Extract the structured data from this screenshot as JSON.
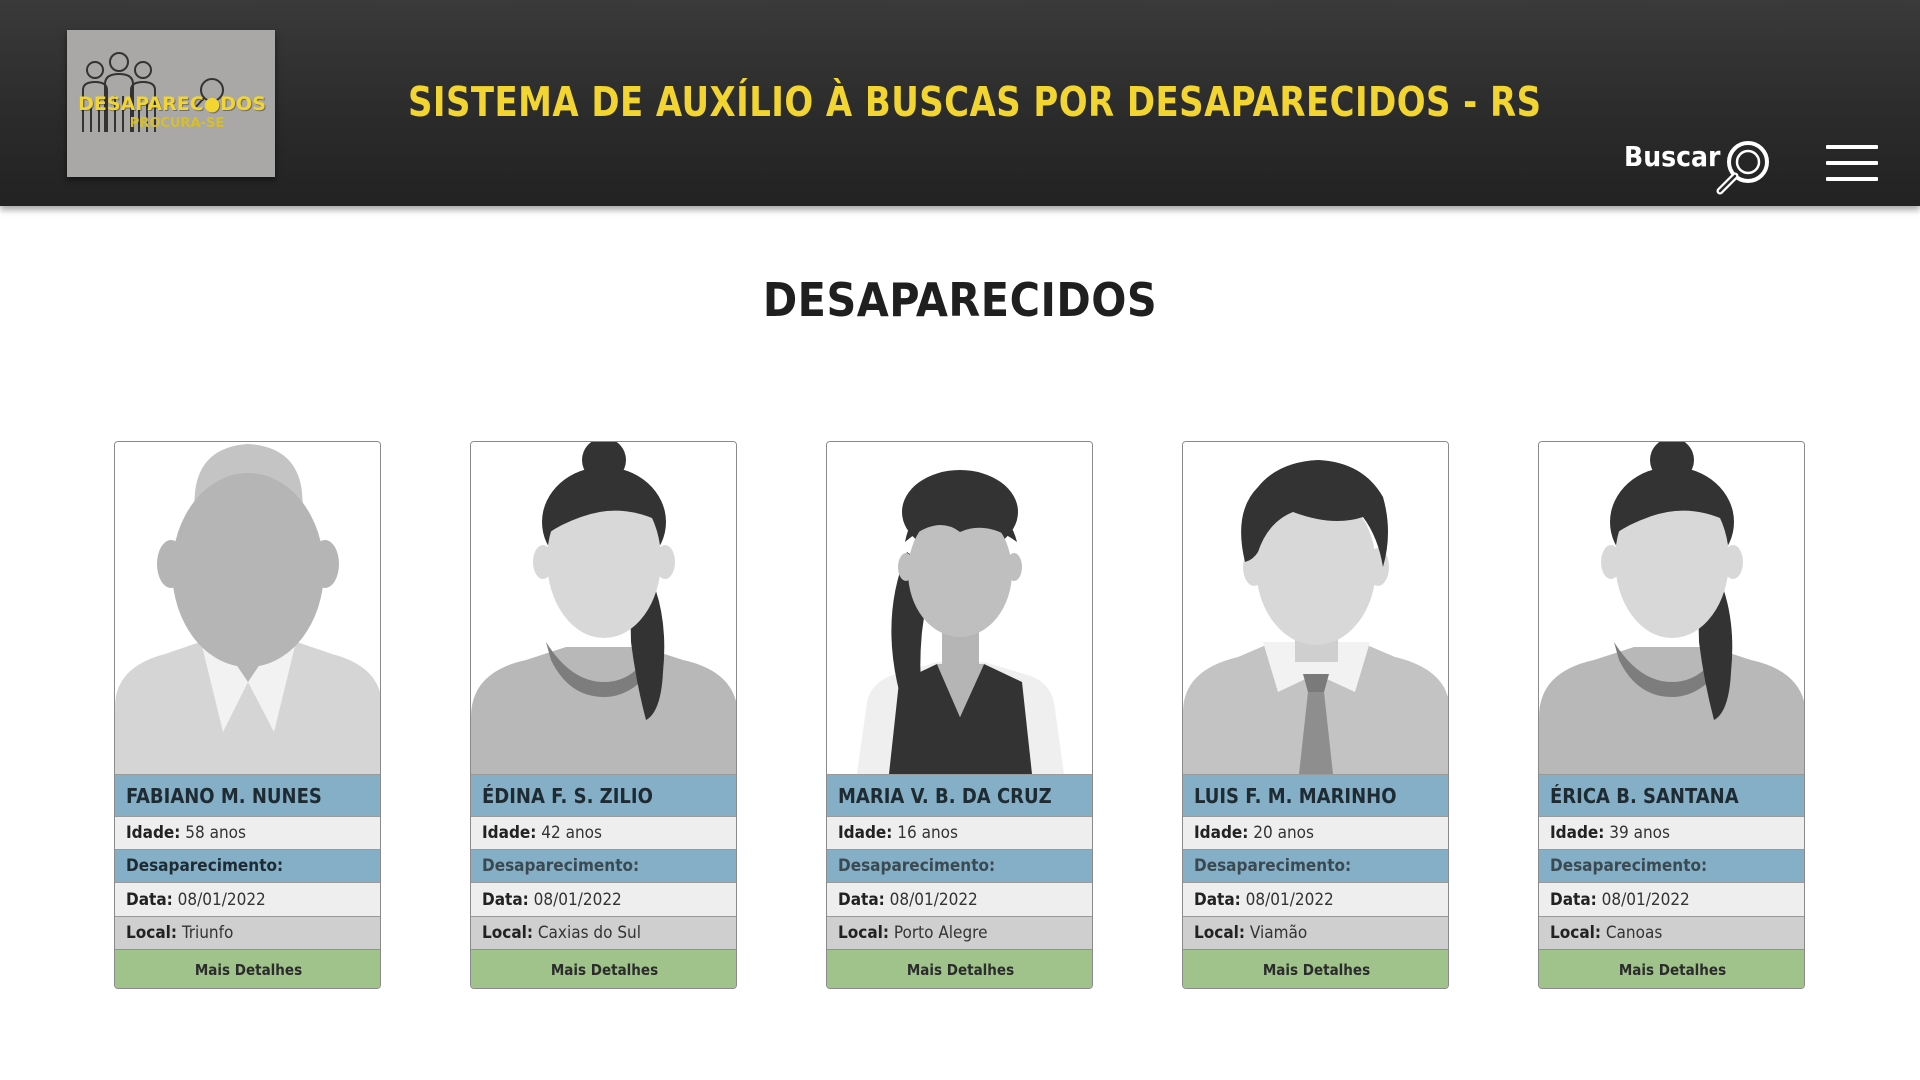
{
  "header": {
    "logo_title": "DESAPAREC●DOS",
    "logo_subtitle": "PROCURA-SE",
    "site_title": "SISTEMA DE AUXÍLIO À BUSCAS POR DESAPARECIDOS - RS",
    "search_label": "Buscar"
  },
  "section_title": "DESAPARECIDOS",
  "labels": {
    "idade": "Idade:",
    "desaparecimento": "Desaparecimento:",
    "data": "Data:",
    "local": "Local:",
    "more_details": "Mais Detalhes"
  },
  "people": [
    {
      "name": "FABIANO M. NUNES",
      "age": "58 anos",
      "date": "08/01/2022",
      "local": "Triunfo",
      "avatar": "male-placeholder-icon"
    },
    {
      "name": "ÉDINA F. S. ZILIO",
      "age": "42 anos",
      "date": "08/01/2022",
      "local": "Caxias do Sul",
      "avatar": "female-bun-icon"
    },
    {
      "name": "MARIA V. B. DA CRUZ",
      "age": "16 anos",
      "date": "08/01/2022",
      "local": "Porto Alegre",
      "avatar": "female-ponytail-icon"
    },
    {
      "name": "LUIS F. M. MARINHO",
      "age": "20 anos",
      "date": "08/01/2022",
      "local": "Viamão",
      "avatar": "male-tie-icon"
    },
    {
      "name": "ÉRICA B. SANTANA",
      "age": "39 anos",
      "date": "08/01/2022",
      "local": "Canoas",
      "avatar": "female-bun-icon"
    }
  ],
  "colors": {
    "header_bg": "#2a2a2a",
    "accent_yellow": "#f2d531",
    "name_row": "#84afc6",
    "button_green": "#9fc38a"
  }
}
